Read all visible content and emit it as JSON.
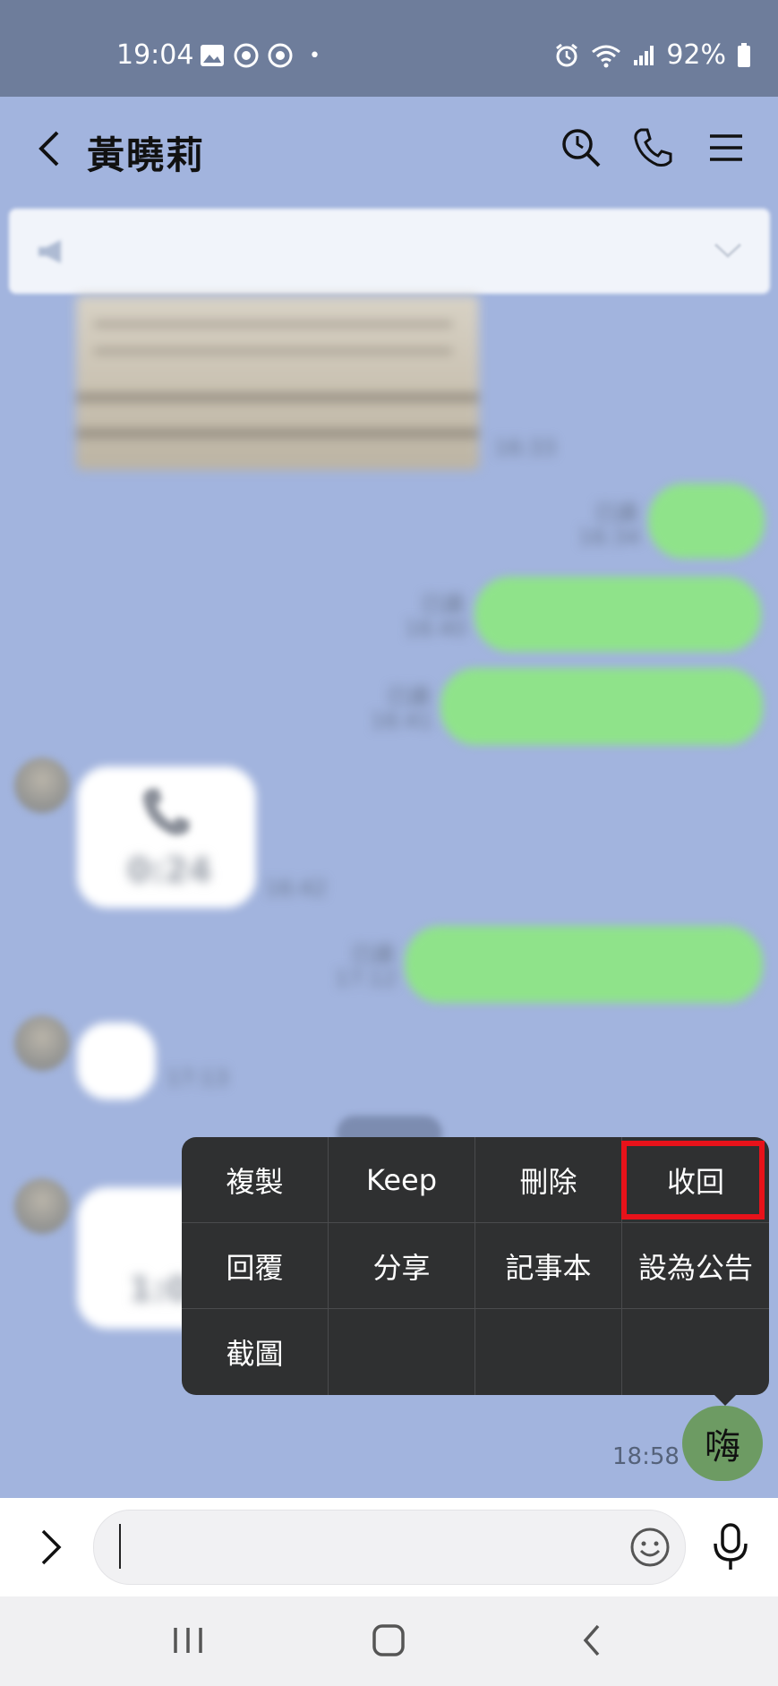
{
  "status_bar": {
    "time": "19:04",
    "battery": "92%"
  },
  "header": {
    "title": "黃曉莉"
  },
  "messages": {
    "ts1": "16:33",
    "read1": "已讀",
    "ts2": "16:34",
    "read2": "已讀",
    "ts3": "16:40",
    "read3": "已讀",
    "ts4": "16:41",
    "call_duration": "0:24",
    "ts5": "16:42",
    "read5": "已讀",
    "ts6": "17:12",
    "ts7": "17:13",
    "call_duration2": "1:03",
    "selected_text": "嗨",
    "selected_time": "18:58"
  },
  "context_menu": {
    "items": [
      "複製",
      "Keep",
      "刪除",
      "收回",
      "回覆",
      "分享",
      "記事本",
      "設為公告",
      "截圖"
    ]
  },
  "colors": {
    "chat_background": "#a2b4de",
    "menu_background": "#2f3031",
    "highlight": "#e8121a",
    "bubble_green": "#8fe38a"
  }
}
